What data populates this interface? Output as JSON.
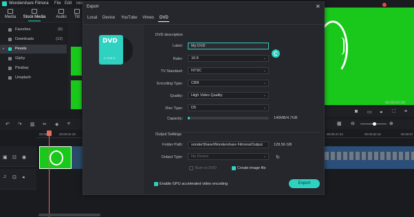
{
  "app": {
    "title": "Wondershare Filmora",
    "menu": [
      "File",
      "Edit",
      "Tools"
    ]
  },
  "left_tabs": [
    {
      "label": "Media"
    },
    {
      "label": "Stock Media"
    },
    {
      "label": "Audio"
    },
    {
      "label": "Titl"
    }
  ],
  "sidebar": {
    "items": [
      {
        "label": "Favorites",
        "count": "(0)"
      },
      {
        "label": "Downloads",
        "count": "(12)"
      },
      {
        "label": "Pexels",
        "count": ""
      },
      {
        "label": "Giphy",
        "count": ""
      },
      {
        "label": "Pixabay",
        "count": ""
      },
      {
        "label": "Unsplash",
        "count": ""
      }
    ]
  },
  "dialog": {
    "title": "Export",
    "tabs": [
      "Local",
      "Device",
      "YouTube",
      "Vimeo",
      "DVD"
    ],
    "active_tab": "DVD",
    "dvd_icon_text": "DVD",
    "dvd_icon_subtext": "VIDEO",
    "dvd_section": "DVD description",
    "fields": {
      "label": {
        "label": "Label:",
        "value": "My DVD"
      },
      "ratio": {
        "label": "Ratio:",
        "value": "16:9"
      },
      "tv_standard": {
        "label": "TV Standard:",
        "value": "NTSC"
      },
      "encoding_type": {
        "label": "Encoding Type:",
        "value": "CBR"
      },
      "quality": {
        "label": "Quality:",
        "value": "High Video Quality"
      },
      "disc_type": {
        "label": "Disc Type:",
        "value": "D5"
      },
      "capacity": {
        "label": "Capacity:",
        "value": "140MB/4.7GB"
      }
    },
    "output_section": "Output Settings",
    "folder_path": {
      "label": "Folder Path:",
      "value": "sonderShare/Wondershare Filmora/Output",
      "size": "128.56 GB"
    },
    "output_type": {
      "label": "Output Type:",
      "value": "No Device"
    },
    "burn_to_dvd": "Burn to DVD",
    "create_image_file": "Create image file",
    "gpu_accel": "Enable GPU accelerated video encoding",
    "export_button": "Export"
  },
  "preview": {
    "time": "00:00:02:00"
  },
  "timeline": {
    "ruler": [
      "00:00",
      "00:00:04:19",
      "00:00:47:23",
      "00:00:52:18",
      "00:00:57"
    ]
  },
  "colors": {
    "accent": "#2fd1c1",
    "green_screen": "#19c81a",
    "playhead": "#e86b5c"
  },
  "icons": [
    "dvd-disc-icon",
    "refresh-icon",
    "close-icon",
    "dropdown-icon"
  ]
}
